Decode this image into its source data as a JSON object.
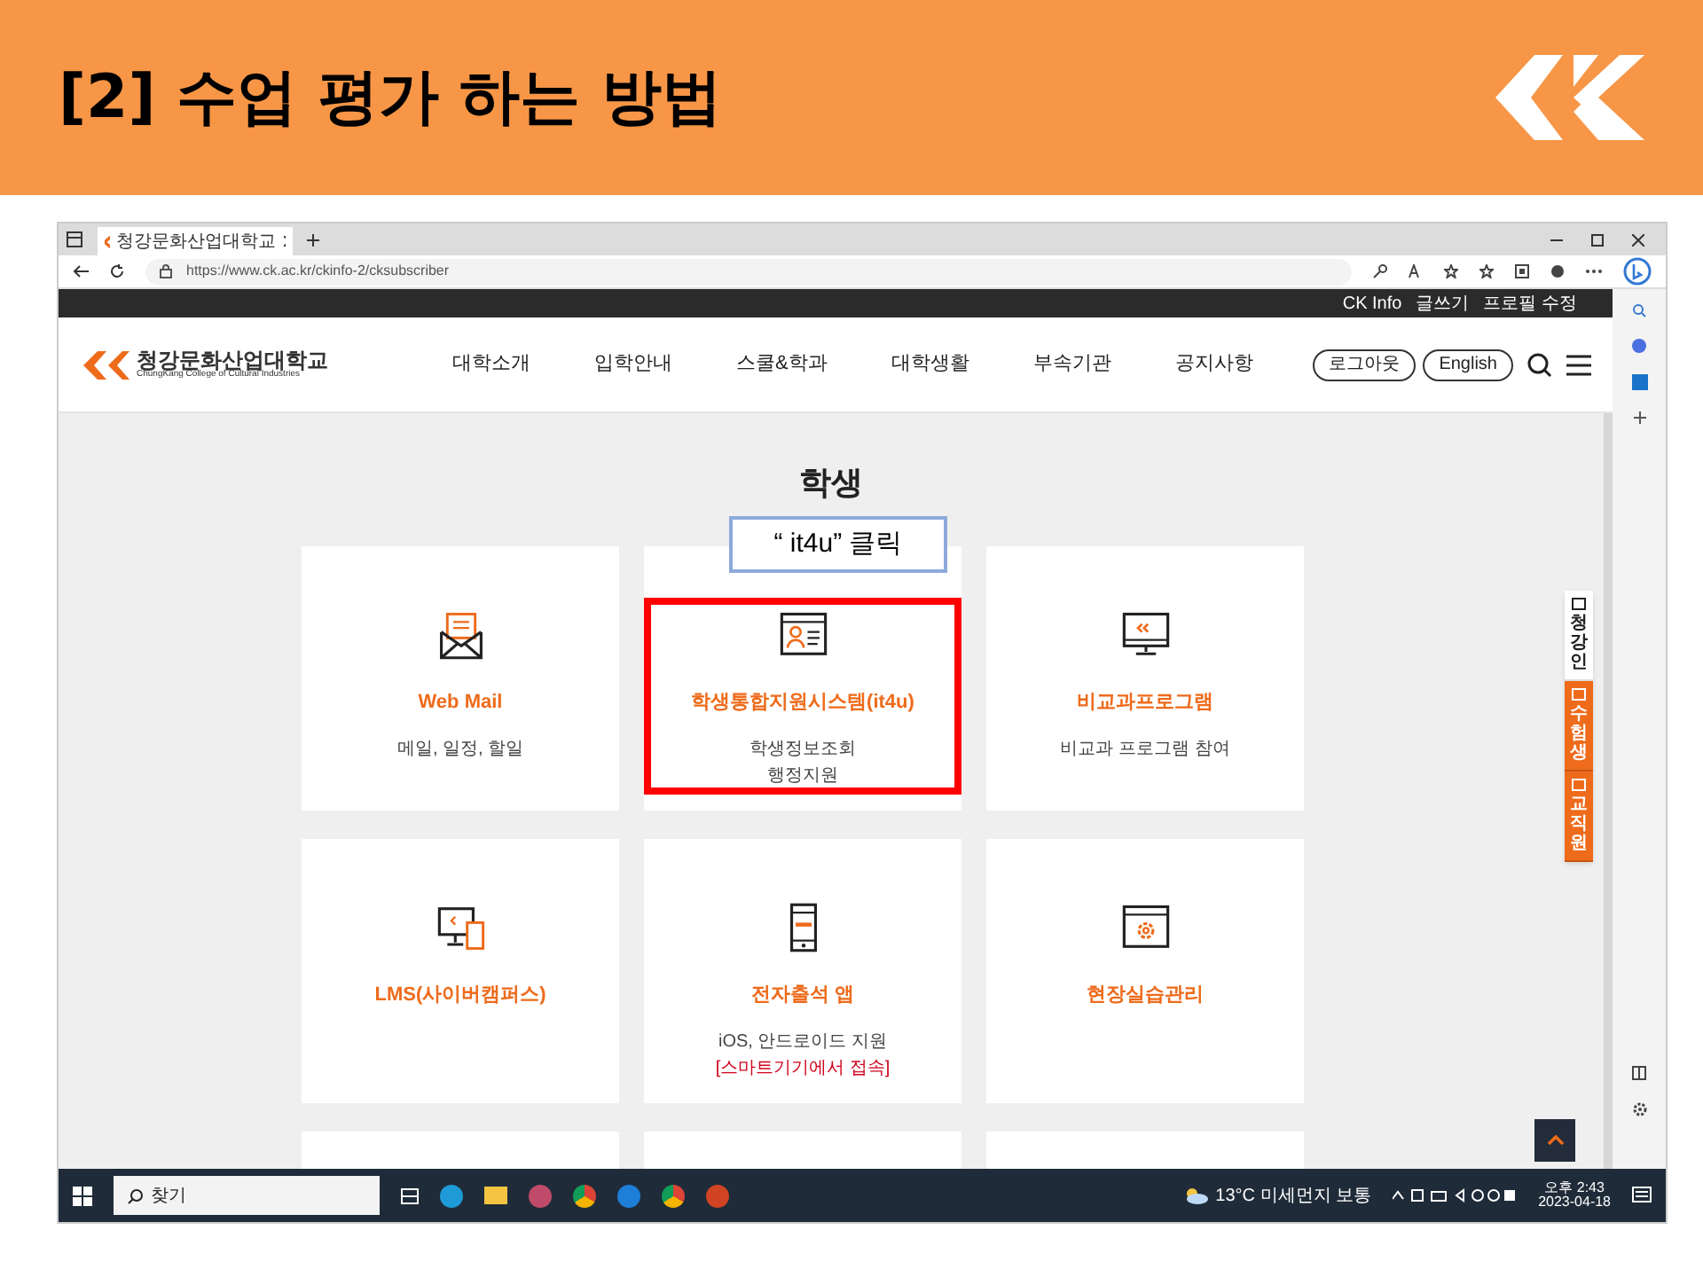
{
  "slide": {
    "title": "[2] 수업 평가 하는 방법"
  },
  "browser": {
    "tab": "청강문화산업대학교",
    "url": "https://www.ck.ac.kr/ckinfo-2/cksubscriber"
  },
  "topbar": [
    "CK Info",
    "글쓰기",
    "프로필 수정"
  ],
  "site": {
    "logo": "청강문화산업대학교",
    "logo_sub": "ChungKang College of Cultural Industries",
    "nav": [
      "대학소개",
      "입학안내",
      "스쿨&학과",
      "대학생활",
      "부속기관",
      "공지사항"
    ],
    "buttons": [
      "로그아웃",
      "English"
    ]
  },
  "page": {
    "heading": "학생",
    "callout": "“ it4u” 클릭",
    "cards": [
      {
        "title": "Web Mail",
        "lines": [
          {
            "text": "메일, 일정, 할일",
            "kind": "plain"
          }
        ],
        "highlighted": false
      },
      {
        "title": "학생통합지원시스템(it4u)",
        "lines": [
          {
            "text": "학생정보조회",
            "kind": "plain"
          },
          {
            "text": "행정지원",
            "kind": "plain"
          }
        ],
        "highlighted": true
      },
      {
        "title": "비교과프로그램",
        "lines": [
          {
            "text": "비교과 프로그램 참여",
            "kind": "plain"
          }
        ],
        "highlighted": false
      },
      {
        "title": "LMS(사이버캠퍼스)",
        "highlighted": false
      },
      {
        "title": "전자출석 앱",
        "lines": [
          {
            "text": "iOS, 안드로이드 지원",
            "kind": "plain"
          },
          {
            "text": "[스마트기기에서 접속]",
            "kind": "notice"
          }
        ],
        "highlighted": false
      },
      {
        "title": "현장실습관리",
        "highlighted": false
      }
    ],
    "side_tabs": [
      {
        "label": "청강인",
        "kind": "light"
      },
      {
        "label": "수험생",
        "kind": "accent"
      },
      {
        "label": "교직원",
        "kind": "accent"
      }
    ]
  },
  "taskbar": {
    "search": "찾기",
    "weather": "13°C 미세먼지 보통",
    "time": "오후 2:43",
    "date": "2023-04-18"
  }
}
